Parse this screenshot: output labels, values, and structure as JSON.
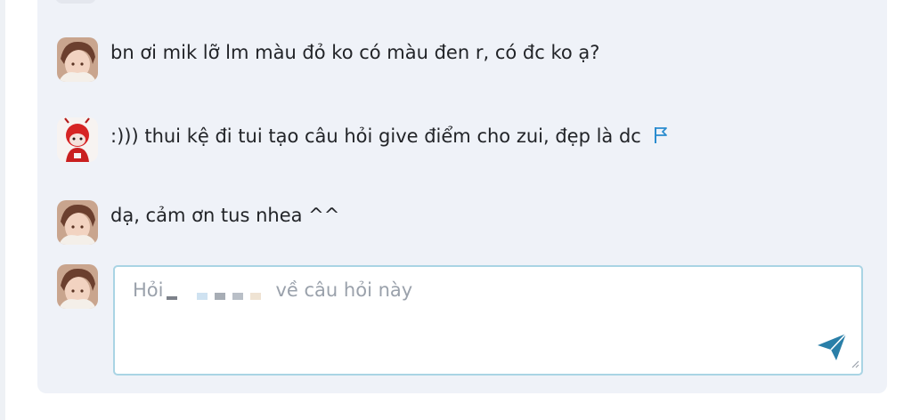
{
  "comments": [
    {
      "avatar_icon": "user-avatar-icon",
      "text": "bn ơi mik lỡ lm màu đỏ ko có màu đen r, có đc ko ạ?"
    },
    {
      "avatar_icon": "user-avatar-icon",
      "text": ":))) thui kệ đi tui tạo câu hỏi give điểm cho zui, đẹp là dc",
      "action_icon": "flag-icon"
    },
    {
      "avatar_icon": "user-avatar-icon",
      "text": "dạ, cảm ơn tus nhea ^^"
    }
  ],
  "reply": {
    "placeholder_prefix": "Hỏi",
    "placeholder_suffix": "về câu hỏi này",
    "send_icon": "send-icon"
  },
  "colors": {
    "panel_bg": "#eff2f8",
    "text": "#222428",
    "placeholder": "#9aa1ab",
    "accent": "#2a8ccf",
    "send": "#2a7fa8",
    "input_border": "#a9d4e4"
  }
}
